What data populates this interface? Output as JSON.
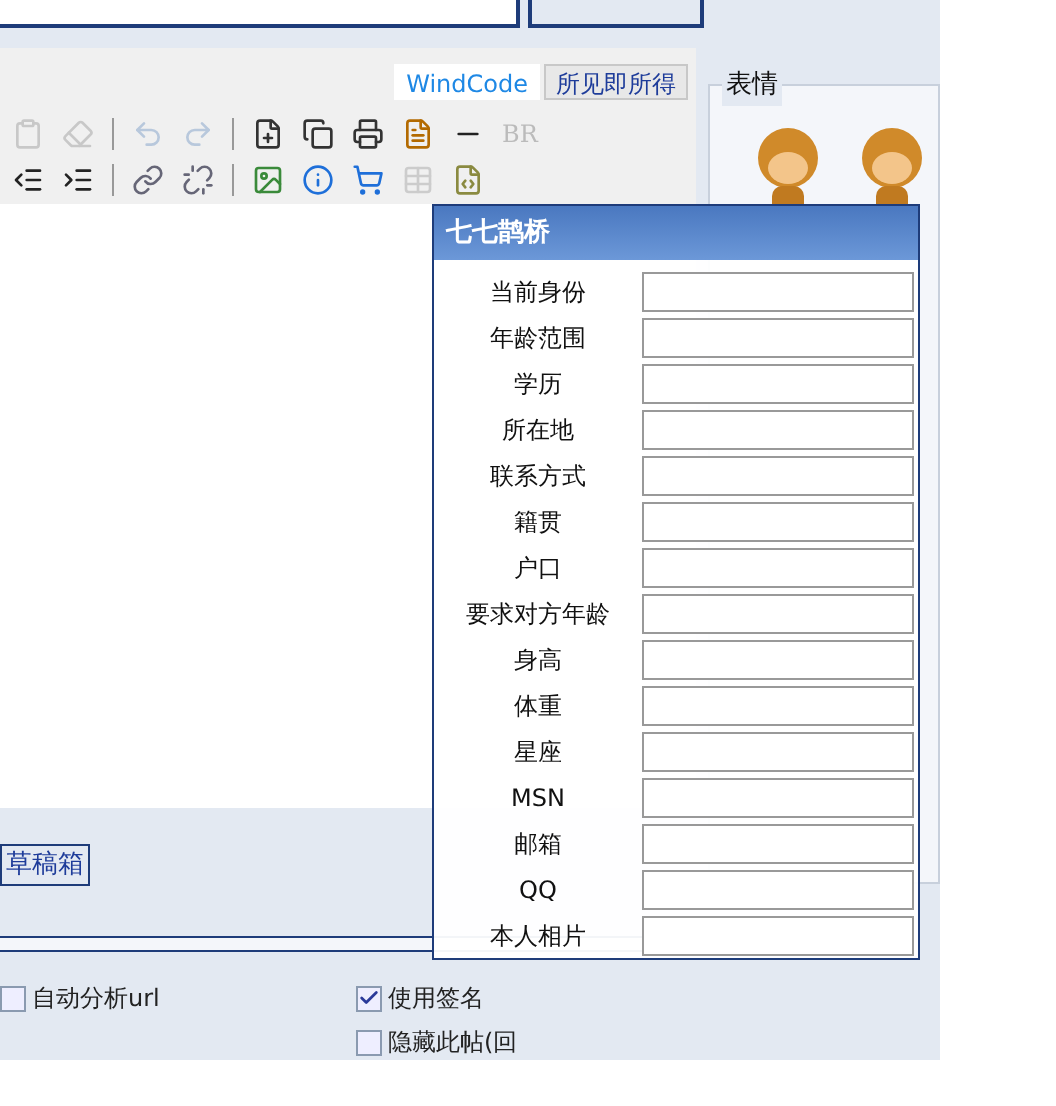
{
  "editor": {
    "tabs": [
      {
        "label": "WindCode",
        "selected": true
      },
      {
        "label": "所见即所得",
        "selected": false
      }
    ],
    "toolbar_text": "BR",
    "draft_button": "草稿箱"
  },
  "emoticons": {
    "title": "表情"
  },
  "options": [
    {
      "label": "自动分析url",
      "checked": false
    },
    {
      "label": "使用签名",
      "checked": true
    },
    {
      "label": "隐藏此帖(回",
      "checked": false
    }
  ],
  "dialog": {
    "title": "七七鹊桥",
    "fields": [
      {
        "label": "当前身份"
      },
      {
        "label": "年龄范围"
      },
      {
        "label": "学历"
      },
      {
        "label": "所在地"
      },
      {
        "label": "联系方式"
      },
      {
        "label": "籍贯"
      },
      {
        "label": "户口"
      },
      {
        "label": "要求对方年龄"
      },
      {
        "label": "身高"
      },
      {
        "label": "体重"
      },
      {
        "label": "星座"
      },
      {
        "label": "MSN"
      },
      {
        "label": "邮箱"
      },
      {
        "label": "QQ"
      },
      {
        "label": "本人相片"
      }
    ]
  }
}
